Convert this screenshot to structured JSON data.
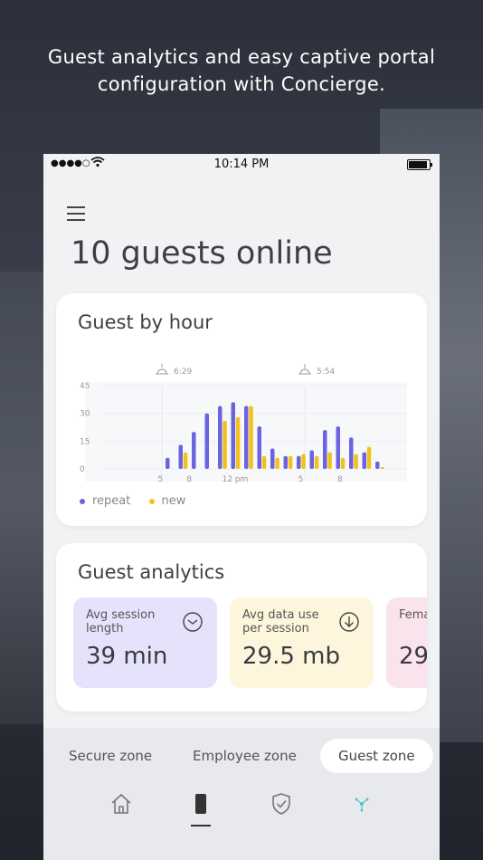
{
  "headline": {
    "line1": "Guest analytics and easy captive portal",
    "line2": "configuration with Concierge."
  },
  "status_bar": {
    "signal": "●●●●○",
    "time": "10:14 PM"
  },
  "page": {
    "title": "10 guests online"
  },
  "guest_by_hour": {
    "title": "Guest by hour",
    "sunrise": "6:29",
    "sunset": "5:54",
    "legend": [
      {
        "label": "repeat",
        "color": "#6b63e0"
      },
      {
        "label": "new",
        "color": "#f2c21b"
      }
    ]
  },
  "chart_data": {
    "type": "bar",
    "title": "Guest by hour",
    "ylim": [
      0,
      45
    ],
    "yticks": [
      "0",
      "15",
      "30",
      "45"
    ],
    "xtick_labels": [
      "5",
      "8",
      "12 pm",
      "5",
      "8"
    ],
    "series": [
      {
        "name": "repeat",
        "color": "#6b63e0",
        "values": [
          0,
          0,
          0,
          6,
          13,
          20,
          30,
          34,
          36,
          34,
          23,
          11,
          7,
          7,
          10,
          21,
          23,
          17,
          9,
          4
        ]
      },
      {
        "name": "new",
        "color": "#f2c21b",
        "values": [
          0,
          0,
          0,
          0,
          9,
          0,
          0,
          26,
          28,
          34,
          7,
          6,
          7,
          8,
          7,
          9,
          6,
          8,
          12,
          1
        ]
      }
    ]
  },
  "guest_analytics": {
    "title": "Guest analytics",
    "tiles": [
      {
        "label": "Avg session length",
        "value": "39 min",
        "bg": "#e4e3fb",
        "icon": "clock-icon"
      },
      {
        "label": "Avg data use per session",
        "value": "29.5 mb",
        "bg": "#fdf6dc",
        "icon": "download-icon"
      },
      {
        "label": "Female",
        "value": "29",
        "bg": "#fbe3ee",
        "icon": ""
      }
    ]
  },
  "zones": {
    "items": [
      {
        "label": "Secure zone"
      },
      {
        "label": "Employee zone"
      },
      {
        "label": "Guest zone"
      }
    ],
    "active": "Guest zone"
  },
  "bottom_nav": {
    "items": [
      "home-icon",
      "device-icon",
      "shield-icon",
      "network-icon"
    ],
    "active": "device-icon"
  }
}
